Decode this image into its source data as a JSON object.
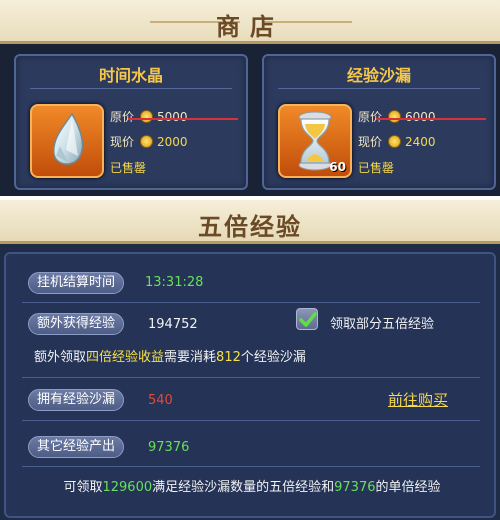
{
  "shop": {
    "title": "商店",
    "items": [
      {
        "name": "时间水晶",
        "icon": "crystal-icon",
        "original_label": "原价",
        "original_price": "5000",
        "current_label": "现价",
        "current_price": "2000",
        "status": "已售罄",
        "quantity": ""
      },
      {
        "name": "经验沙漏",
        "icon": "hourglass-icon",
        "original_label": "原价",
        "original_price": "6000",
        "current_label": "现价",
        "current_price": "2400",
        "status": "已售罄",
        "quantity": "60"
      }
    ]
  },
  "exp": {
    "title": "五倍经验",
    "afk_time_label": "挂机结算时间",
    "afk_time_value": "13:31:28",
    "extra_exp_label": "额外获得经验",
    "extra_exp_value": "194752",
    "claim_partial_label": "领取部分五倍经验",
    "claim_partial_checked": true,
    "cost_note": {
      "prefix": "额外领取",
      "highlight": "四倍经验收益",
      "middle": "需要消耗",
      "amount": "812",
      "suffix": "个经验沙漏"
    },
    "owned_hourglass_label": "拥有经验沙漏",
    "owned_hourglass_value": "540",
    "buy_link": "前往购买",
    "other_exp_label": "其它经验产出",
    "other_exp_value": "97376",
    "summary": {
      "part1": "可领取",
      "value1": "129600",
      "part2": "满足经验沙漏数量的五倍经验和",
      "value2": "97376",
      "part3": "的单倍经验"
    }
  },
  "colors": {
    "panel_bg": "#1f2c47",
    "header_bg": "#f6efd9",
    "green_value": "#67e05a",
    "red_value": "#e34a3a",
    "gold_text": "#f5d84c"
  }
}
